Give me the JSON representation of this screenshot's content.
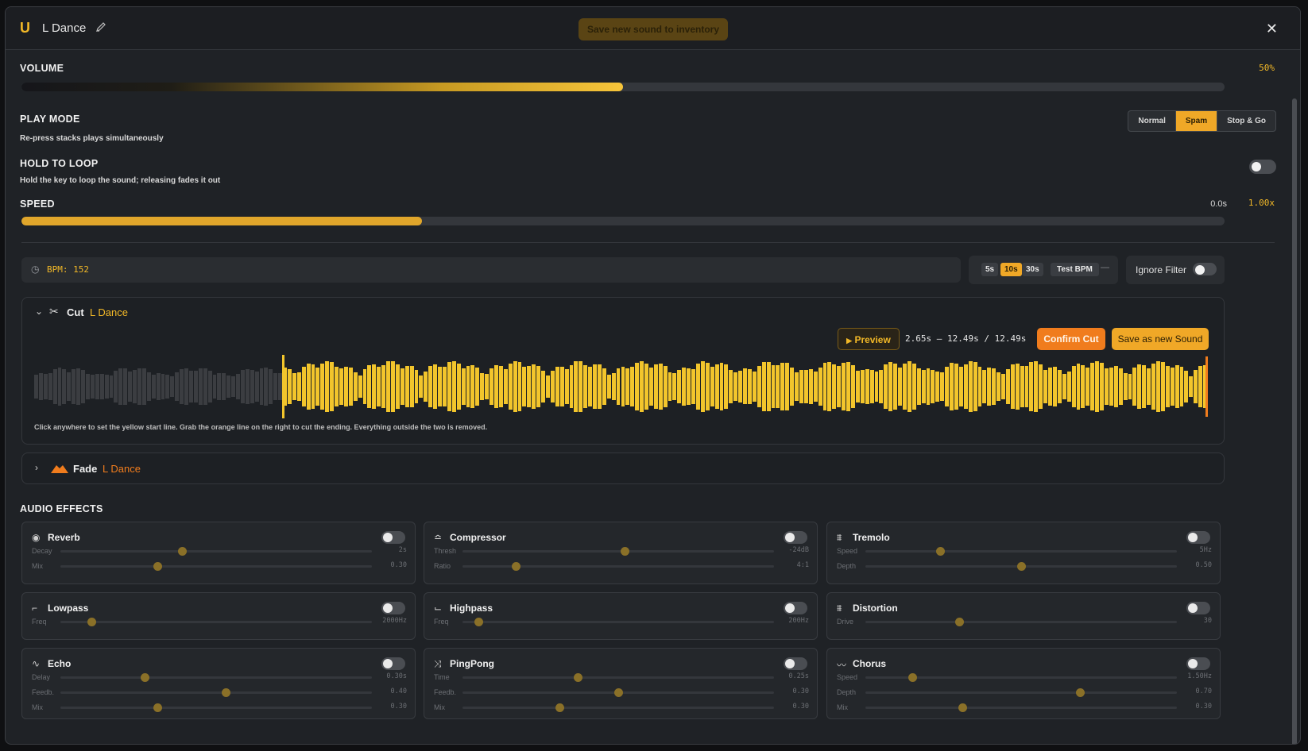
{
  "header": {
    "logo": "U",
    "title": "L Dance",
    "save_inventory": "Save new sound to inventory"
  },
  "volume": {
    "label": "VOLUME",
    "value_text": "50%",
    "level": 0.5
  },
  "play_mode": {
    "label": "PLAY MODE",
    "description": "Re-press stacks plays simultaneously",
    "options": [
      "Normal",
      "Spam",
      "Stop & Go"
    ],
    "selected": "Spam"
  },
  "hold_to_loop": {
    "label": "HOLD TO LOOP",
    "description": "Hold the key to loop the sound; releasing fades it out",
    "enabled": false
  },
  "speed": {
    "label": "SPEED",
    "time": "0.0s",
    "value_text": "1.00x",
    "level": 0.333
  },
  "bpm": {
    "text": "BPM: 152"
  },
  "test": {
    "durations": [
      "5s",
      "10s",
      "30s"
    ],
    "selected": "10s",
    "test_bpm": "Test BPM",
    "dash": "—"
  },
  "ignore_filter": {
    "label": "Ignore Filter",
    "enabled": false
  },
  "cut": {
    "label": "Cut",
    "name": "L Dance",
    "preview": "Preview",
    "range_text": "2.65s – 12.49s / 12.49s",
    "confirm": "Confirm Cut",
    "save_new": "Save as new Sound",
    "start_fraction": 0.212,
    "hint": "Click anywhere to set the yellow start line. Grab the orange line on the right to cut the ending. Everything outside the two is removed."
  },
  "fade": {
    "label": "Fade",
    "name": "L Dance"
  },
  "audio_effects": {
    "label": "AUDIO EFFECTS",
    "effects": [
      {
        "name": "Reverb",
        "icon": "reverb-icon",
        "params": [
          {
            "label": "Decay",
            "value": "2s",
            "level": 0.39
          },
          {
            "label": "Mix",
            "value": "0.30",
            "level": 0.31
          }
        ]
      },
      {
        "name": "Compressor",
        "icon": "compressor-icon",
        "params": [
          {
            "label": "Thresh",
            "value": "-24dB",
            "level": 0.52
          },
          {
            "label": "Ratio",
            "value": "4:1",
            "level": 0.17
          }
        ]
      },
      {
        "name": "Tremolo",
        "icon": "tremolo-icon",
        "params": [
          {
            "label": "Speed",
            "value": "5Hz",
            "level": 0.24
          },
          {
            "label": "Depth",
            "value": "0.50",
            "level": 0.5
          }
        ]
      },
      {
        "name": "Lowpass",
        "icon": "lowpass-icon",
        "params": [
          {
            "label": "Freq",
            "value": "2000Hz",
            "level": 0.1
          }
        ]
      },
      {
        "name": "Highpass",
        "icon": "highpass-icon",
        "params": [
          {
            "label": "Freq",
            "value": "200Hz",
            "level": 0.05
          }
        ]
      },
      {
        "name": "Distortion",
        "icon": "distortion-icon",
        "params": [
          {
            "label": "Drive",
            "value": "30",
            "level": 0.3
          }
        ]
      },
      {
        "name": "Echo",
        "icon": "echo-icon",
        "params": [
          {
            "label": "Delay",
            "value": "0.30s",
            "level": 0.27
          },
          {
            "label": "Feedb.",
            "value": "0.40",
            "level": 0.53
          },
          {
            "label": "Mix",
            "value": "0.30",
            "level": 0.31
          }
        ]
      },
      {
        "name": "PingPong",
        "icon": "pingpong-icon",
        "params": [
          {
            "label": "Time",
            "value": "0.25s",
            "level": 0.37
          },
          {
            "label": "Feedb.",
            "value": "0.30",
            "level": 0.5
          },
          {
            "label": "Mix",
            "value": "0.30",
            "level": 0.31
          }
        ]
      },
      {
        "name": "Chorus",
        "icon": "chorus-icon",
        "params": [
          {
            "label": "Speed",
            "value": "1.50Hz",
            "level": 0.15
          },
          {
            "label": "Depth",
            "value": "0.70",
            "level": 0.69
          },
          {
            "label": "Mix",
            "value": "0.30",
            "level": 0.31
          }
        ]
      }
    ]
  },
  "colors": {
    "accent": "#f2b827",
    "orange": "#f07c1d",
    "dark": "#1f2226"
  }
}
